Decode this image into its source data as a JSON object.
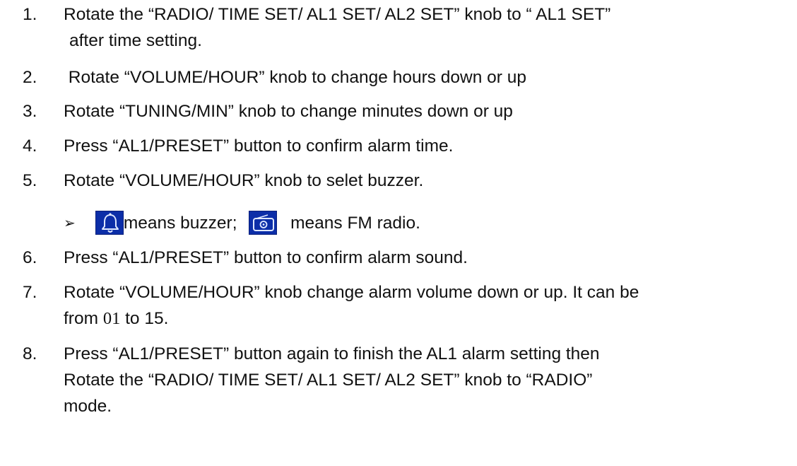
{
  "items": [
    {
      "number": "1.",
      "lines": [
        "Rotate the “RADIO/ TIME SET/ AL1 SET/ AL2 SET” knob to “ AL1 SET”",
        "after time setting."
      ]
    },
    {
      "number": "2.",
      "lines": [
        " Rotate “VOLUME/HOUR” knob to change hours down or up"
      ]
    },
    {
      "number": "3.",
      "lines": [
        "Rotate “TUNING/MIN” knob to change minutes down or up"
      ]
    },
    {
      "number": "4.",
      "lines": [
        "Press “AL1/PRESET” button to confirm alarm time."
      ]
    },
    {
      "number": "5.",
      "lines": [
        "Rotate “VOLUME/HOUR” knob to selet buzzer."
      ]
    },
    {
      "number": "6.",
      "lines": [
        "Press “AL1/PRESET” button to confirm alarm sound."
      ]
    },
    {
      "number": "7.",
      "line1": "Rotate “VOLUME/HOUR” knob change alarm volume down or up. It can be",
      "line2_prefix": "from ",
      "line2_value": "01",
      "line2_suffix": " to 15."
    },
    {
      "number": "8.",
      "lines": [
        "Press “AL1/PRESET” button again to finish the AL1 alarm setting then",
        "Rotate the “RADIO/ TIME SET/ AL1 SET/ AL2 SET” knob to “RADIO”",
        "mode."
      ]
    }
  ],
  "bullet": {
    "marker": "➢",
    "buzzer_icon": "bell-icon",
    "buzzer_text": "means buzzer;",
    "radio_icon": "radio-icon",
    "radio_text": "means FM radio."
  },
  "colors": {
    "icon_background": "#0c2ea8",
    "icon_glyph": "#dfe8ff"
  }
}
